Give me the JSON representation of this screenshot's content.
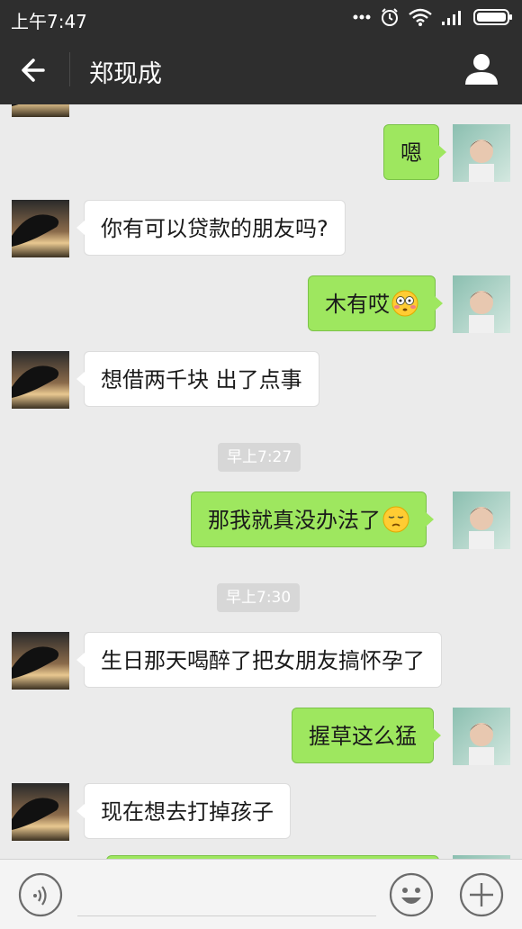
{
  "status": {
    "time": "上午7:47"
  },
  "header": {
    "title": "郑现成"
  },
  "messages": [
    {
      "text": "嗯"
    },
    {
      "text": "你有可以贷款的朋友吗?"
    },
    {
      "text": "木有哎"
    },
    {
      "text": "想借两千块 出了点事"
    },
    {
      "time": "早上7:27"
    },
    {
      "text": "那我就真没办法了"
    },
    {
      "time": "早上7:30"
    },
    {
      "text": "生日那天喝醉了把女朋友搞怀孕了"
    },
    {
      "text": "握草这么猛"
    },
    {
      "text": "现在想去打掉孩子"
    }
  ],
  "colors": {
    "header_bg": "#2e2e2e",
    "outgoing_bubble": "#9ee75f",
    "incoming_bubble": "#ffffff",
    "chat_bg": "#ebebeb"
  },
  "icons": [
    "back-arrow-icon",
    "person-icon",
    "voice-icon",
    "emoji-icon",
    "plus-icon",
    "flushed-face-icon",
    "pensive-face-icon"
  ]
}
